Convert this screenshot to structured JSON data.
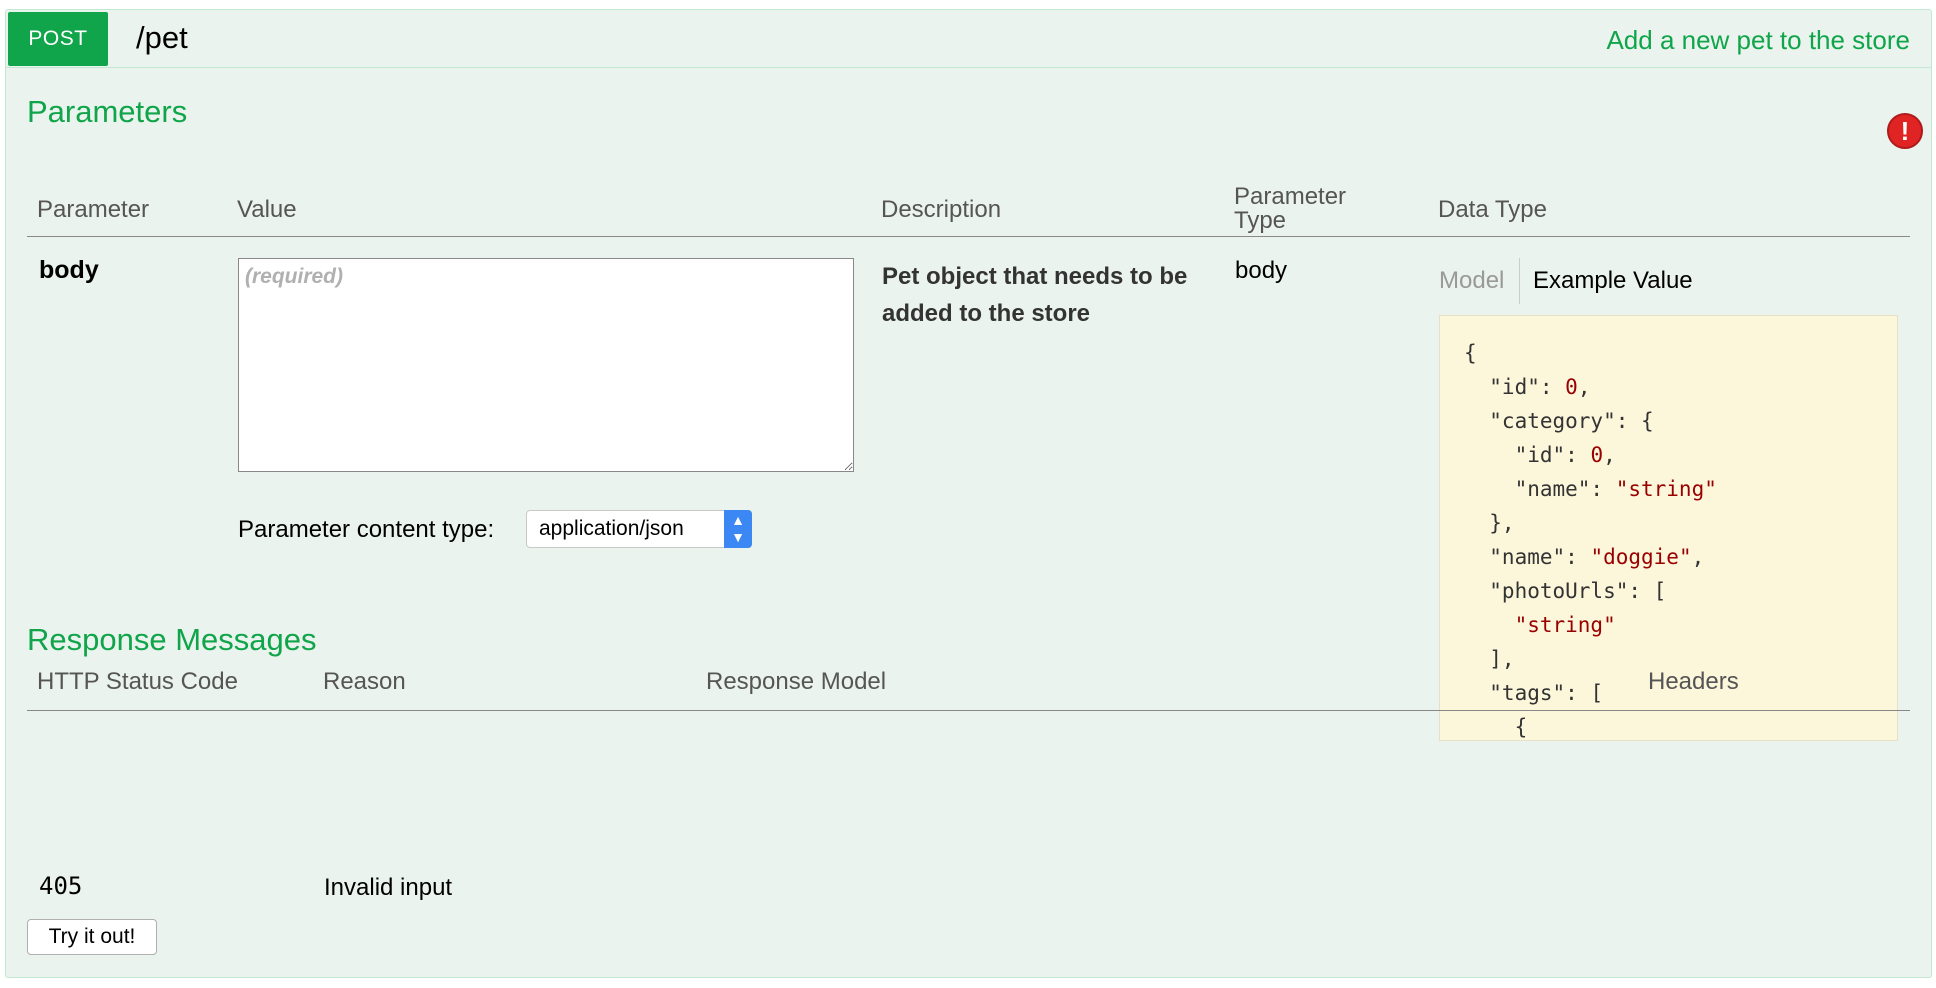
{
  "operation": {
    "method": "POST",
    "path": "/pet",
    "summary": "Add a new pet to the store"
  },
  "parameters": {
    "title": "Parameters",
    "warning_icon": "error-exclamation-icon",
    "headers": {
      "parameter": "Parameter",
      "value": "Value",
      "description": "Description",
      "parameter_type_line1": "Parameter",
      "parameter_type_line2": "Type",
      "data_type": "Data Type"
    },
    "row": {
      "name": "body",
      "value_placeholder": "(required)",
      "content_type_label": "Parameter content type:",
      "content_type_value": "application/json",
      "description": "Pet object that needs to be added to the store",
      "parameter_type": "body"
    },
    "data_type": {
      "model_tab": "Model",
      "example_tab": "Example Value",
      "example_lines": [
        "{",
        "  \"id\": 0,",
        "  \"category\": {",
        "    \"id\": 0,",
        "    \"name\": \"string\"",
        "  },",
        "  \"name\": \"doggie\",",
        "  \"photoUrls\": [",
        "    \"string\"",
        "  ],",
        "  \"tags\": [",
        "    {"
      ]
    }
  },
  "responses": {
    "title": "Response Messages",
    "headers": {
      "status_code": "HTTP Status Code",
      "reason": "Reason",
      "model": "Response Model",
      "headers": "Headers"
    },
    "rows": [
      {
        "code": "405",
        "reason": "Invalid input"
      }
    ]
  },
  "actions": {
    "try_label": "Try it out!"
  },
  "colors": {
    "post_green": "#10a54a",
    "panel_bg": "#ebf3ee",
    "example_bg": "#fcf6db",
    "json_value": "#990000",
    "select_arrow": "#3b88f5"
  }
}
